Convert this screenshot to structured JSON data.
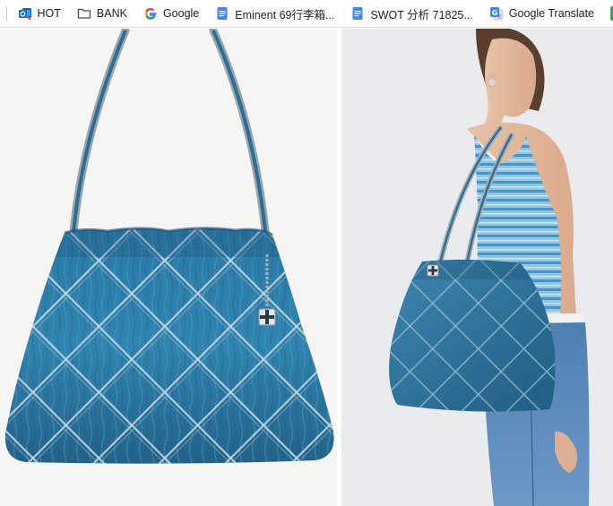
{
  "bookmarks_bar": {
    "items": [
      {
        "label": "HOT",
        "icon": "outlook-folder-icon"
      },
      {
        "label": "BANK",
        "icon": "folder-icon"
      },
      {
        "label": "Google",
        "icon": "google-g-icon"
      },
      {
        "label": "Eminent 69行李箱...",
        "icon": "google-docs-icon"
      },
      {
        "label": "SWOT 分析 71825...",
        "icon": "google-docs-icon"
      },
      {
        "label": "Google Translate",
        "icon": "google-translate-icon"
      }
    ]
  },
  "gallery": {
    "images": [
      {
        "subject": "quilted denim tote bag with chain strap"
      },
      {
        "subject": "model wearing quilted denim tote bag"
      }
    ]
  },
  "colors": {
    "denim": "#2f7ea8",
    "denim_dark": "#1f5f84",
    "chain": "#b9c1c7",
    "panel_left_bg": "#f5f5f4",
    "panel_right_bg": "#e9ebee"
  }
}
